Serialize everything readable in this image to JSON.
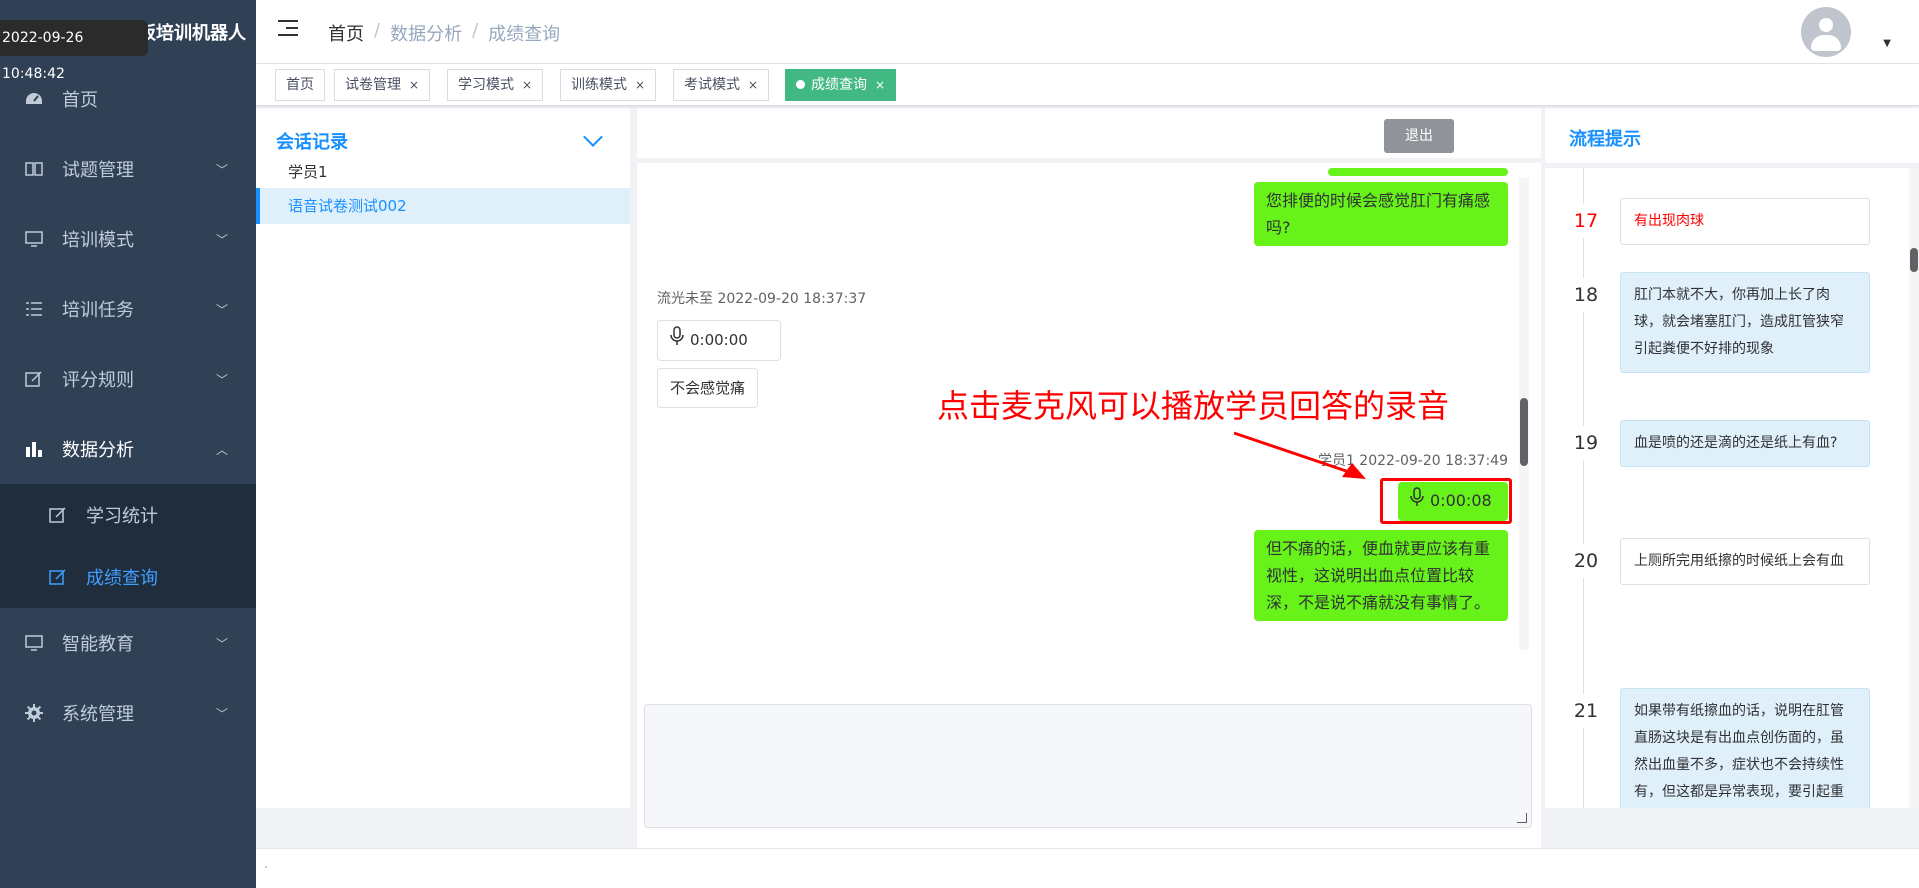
{
  "app": {
    "title": "板培训机器人",
    "time_tip": "2022-09-26 10:48:42"
  },
  "sidebar": {
    "items": [
      {
        "label": "首页",
        "icon": "dashboard-icon"
      },
      {
        "label": "试题管理",
        "icon": "book-icon"
      },
      {
        "label": "培训模式",
        "icon": "monitor-icon"
      },
      {
        "label": "培训任务",
        "icon": "list-icon"
      },
      {
        "label": "评分规则",
        "icon": "edit-icon"
      },
      {
        "label": "数据分析",
        "icon": "chart-icon"
      }
    ],
    "sub_items": [
      {
        "label": "学习统计",
        "icon": "edit-icon"
      },
      {
        "label": "成绩查询",
        "icon": "edit-icon"
      }
    ],
    "bottom_items": [
      {
        "label": "智能教育",
        "icon": "monitor-icon"
      },
      {
        "label": "系统管理",
        "icon": "gear-icon"
      }
    ]
  },
  "breadcrumb": {
    "home": "首页",
    "section": "数据分析",
    "page": "成绩查询",
    "sep": "/"
  },
  "tags": [
    {
      "label": "首页"
    },
    {
      "label": "试卷管理",
      "close": "×"
    },
    {
      "label": "学习模式",
      "close": "×"
    },
    {
      "label": "训练模式",
      "close": "×"
    },
    {
      "label": "考试模式",
      "close": "×"
    },
    {
      "label": "成绩查询",
      "close": "×"
    }
  ],
  "left_panel": {
    "title": "会话记录",
    "items": [
      "学员1",
      "语音试卷测试002"
    ]
  },
  "center": {
    "exit_label": "退出",
    "messages": {
      "q1": "您排便的时候会感觉肛门有痛感吗?",
      "meta1": "流光未至 2022-09-20 18:37:37",
      "audio1": "0:00:00",
      "text1": "不会感觉痛",
      "meta2": "学员1 2022-09-20 18:37:49",
      "audio2": "0:00:08",
      "q2": "但不痛的话，便血就更应该有重视性，这说明出血点位置比较深，不是说不痛就没有事情了。"
    },
    "annotation": "点击麦克风可以播放学员回答的录音"
  },
  "right_panel": {
    "title": "流程提示",
    "steps": [
      {
        "num": "17",
        "text": "有出现肉球"
      },
      {
        "num": "18",
        "text": "肛门本就不大，你再加上长了肉球，就会堵塞肛门，造成肛管狭窄引起粪便不好排的现象"
      },
      {
        "num": "19",
        "text": "血是喷的还是滴的还是纸上有血?"
      },
      {
        "num": "20",
        "text": "上厕所完用纸擦的时候纸上会有血"
      },
      {
        "num": "21",
        "text": "如果带有纸擦血的话，说明在肛管直肠这块是有出血点创伤面的，虽然出血量不多，症状也不会持续性有，但这都是异常表现，要引起重视"
      }
    ]
  },
  "footer": {
    "text": "."
  },
  "colors": {
    "sidebar_bg": "#304156",
    "accent": "#1890ff",
    "bubble_green": "#67f31a",
    "tag_active": "#42b983",
    "annotation": "#ff0000"
  }
}
